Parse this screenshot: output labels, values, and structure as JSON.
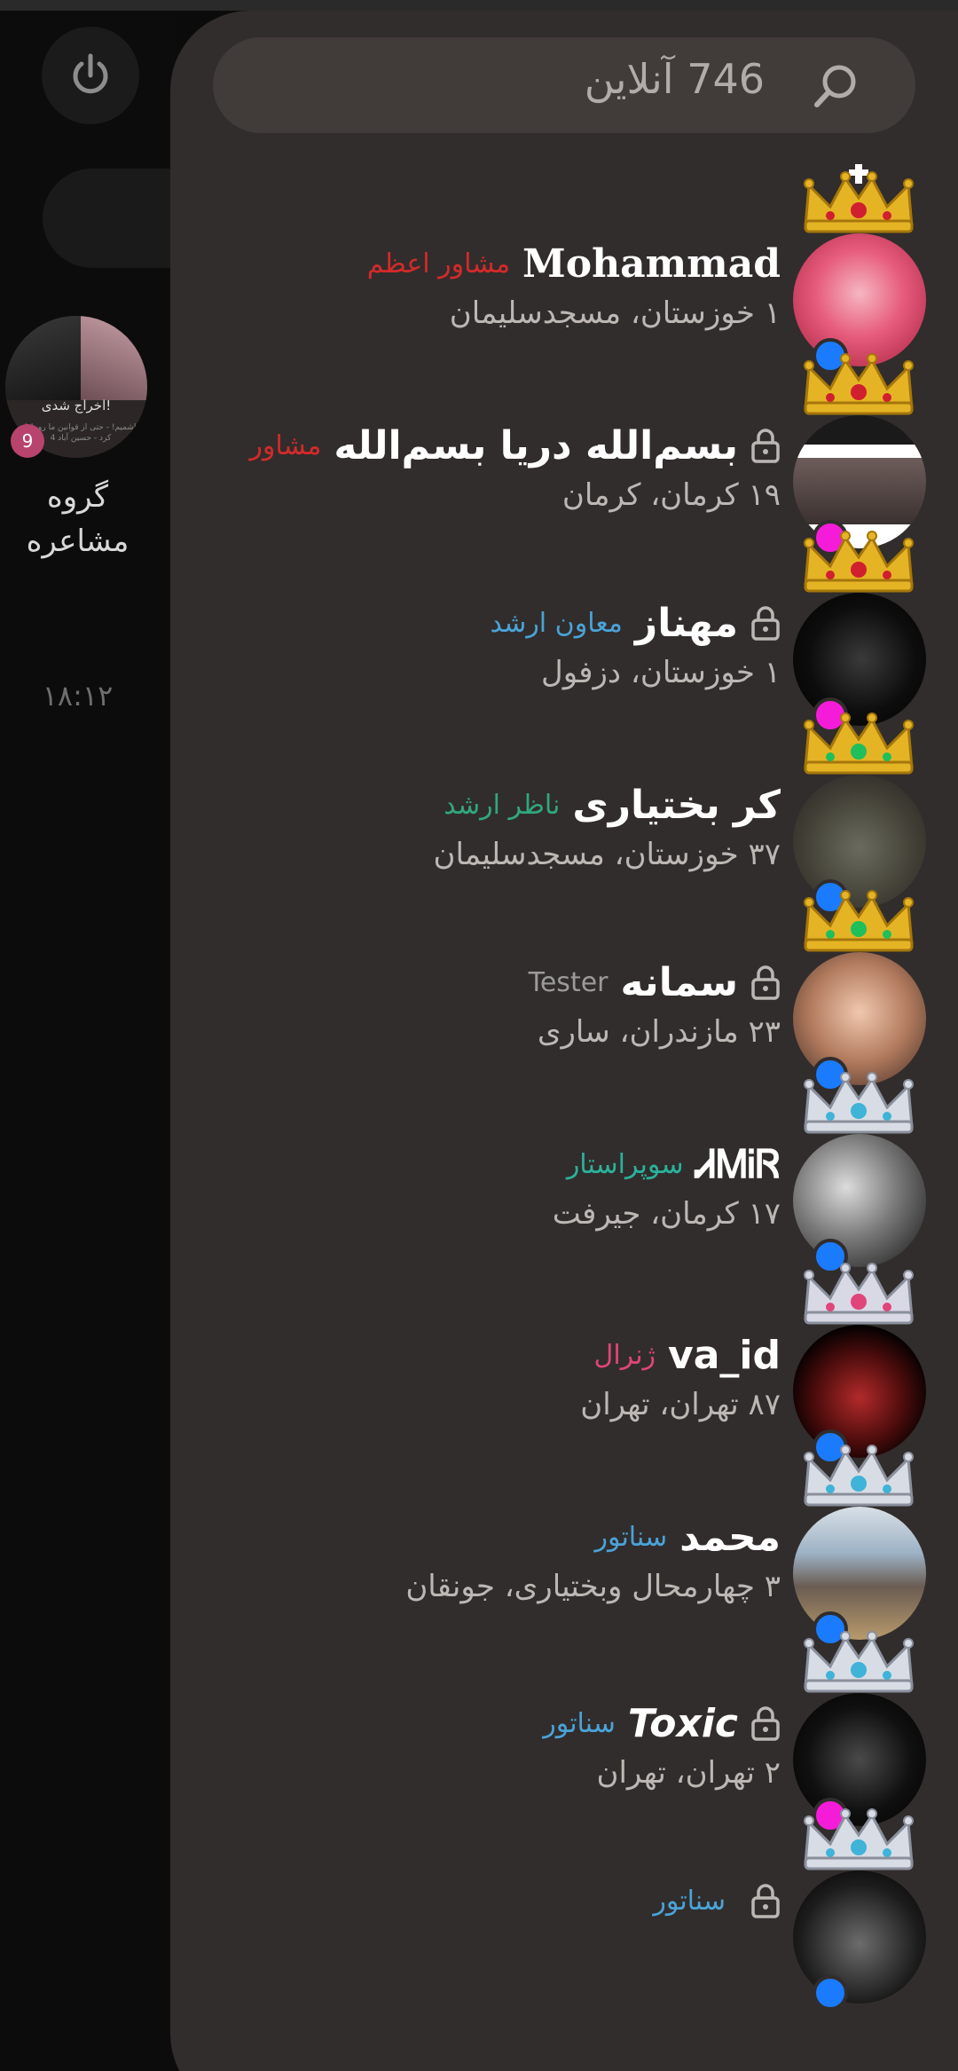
{
  "background": {
    "group": {
      "kicked_text": "اخراج شدی!",
      "preview_text": "حاشمیم! - حتی از قوانین ما رو ناظر کرد - حسین آباد 4",
      "badge_count": "9",
      "name": "گروه مشاعره",
      "time": "۱۸:۱۲"
    }
  },
  "search": {
    "online_text": "746 آنلاین"
  },
  "colors": {
    "drawer": "#312d2c",
    "online_blue": "#1a7bff",
    "online_pink": "#f51cd9",
    "role_red": "#d42a2a",
    "role_blue": "#4aa3d8",
    "role_green": "#2fa87d",
    "role_teal": "#2ab29a",
    "role_pink": "#e0457a",
    "role_gray": "#9a9a9a"
  },
  "users": [
    {
      "name": "Mohammad",
      "role": "مشاور اعظم",
      "location": "۱ خوزستان، مسجدسلیمان",
      "locked": false,
      "status": "blue",
      "crown": "gold-cross-crown"
    },
    {
      "name": "بسم‌الله دریا بسم‌الله",
      "role": "مشاور",
      "location": "۱۹ کرمان، کرمان",
      "locked": true,
      "status": "pink",
      "crown": "gold-crown"
    },
    {
      "name": "مهناز",
      "role": "معاون ارشد",
      "location": "۱ خوزستان، دزفول",
      "locked": true,
      "status": "pink",
      "crown": "gold-crown"
    },
    {
      "name": "کر بختیاری",
      "role": "ناظر ارشد",
      "location": "۳۷ خوزستان، مسجدسلیمان",
      "locked": false,
      "status": "blue",
      "crown": "gold-heart-crown"
    },
    {
      "name": "سمانه",
      "role": "Tester",
      "location": "۲۳ مازندران، ساری",
      "locked": true,
      "status": "blue",
      "crown": "gold-heart-crown"
    },
    {
      "name": "ᏗᎷᎥᏒ",
      "role": "سوپراستار",
      "location": "۱۷ کرمان، جیرفت",
      "locked": false,
      "status": "blue",
      "crown": "silver-crown"
    },
    {
      "name": "va_id",
      "role": "ژنرال",
      "location": "۸۷ تهران، تهران",
      "locked": false,
      "status": "blue",
      "crown": "pink-tiara"
    },
    {
      "name": "محمد",
      "role": "سناتور",
      "location": "۳ چهارمحال وبختیاری، جونقان",
      "locked": false,
      "status": "blue",
      "crown": "silver-tiara"
    },
    {
      "name": "Toxic",
      "role": "سناتور",
      "location": "۲ تهران، تهران",
      "locked": true,
      "status": "pink",
      "crown": "silver-tiara"
    },
    {
      "name": "",
      "role": "سناتور",
      "location": "",
      "locked": true,
      "status": "blue",
      "crown": "silver-tiara"
    }
  ]
}
